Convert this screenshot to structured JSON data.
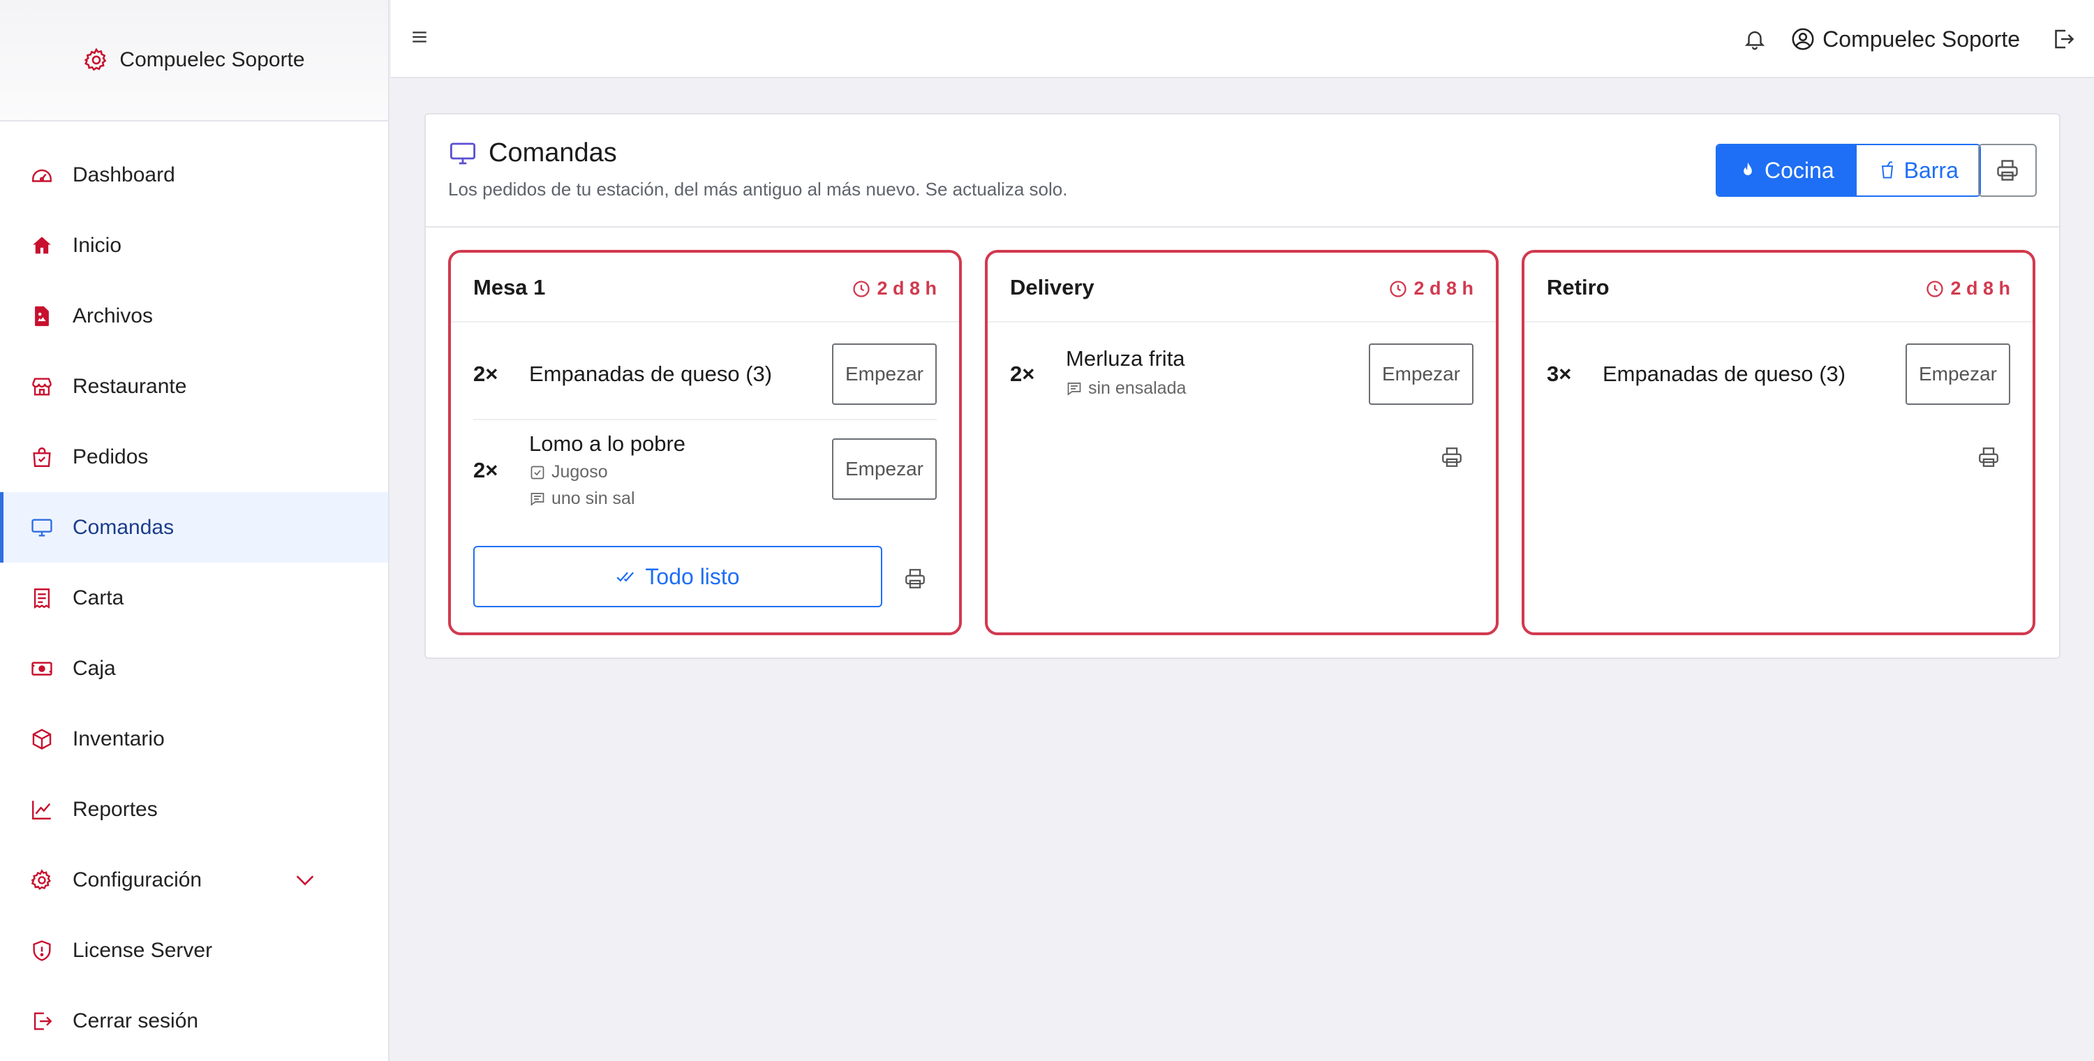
{
  "brand": {
    "name": "Compuelec Soporte"
  },
  "sidebar": {
    "items": [
      {
        "label": "Dashboard",
        "icon": "speedometer-icon"
      },
      {
        "label": "Inicio",
        "icon": "home-icon"
      },
      {
        "label": "Archivos",
        "icon": "file-image-icon"
      },
      {
        "label": "Restaurante",
        "icon": "shop-icon"
      },
      {
        "label": "Pedidos",
        "icon": "bag-check-icon"
      },
      {
        "label": "Comandas",
        "icon": "display-icon",
        "active": true
      },
      {
        "label": "Carta",
        "icon": "receipt-icon"
      },
      {
        "label": "Caja",
        "icon": "cash-icon"
      },
      {
        "label": "Inventario",
        "icon": "box-icon"
      },
      {
        "label": "Reportes",
        "icon": "graph-icon"
      },
      {
        "label": "Configuración",
        "icon": "gear-icon",
        "expandable": true
      },
      {
        "label": "License Server",
        "icon": "shield-icon"
      },
      {
        "label": "Cerrar sesión",
        "icon": "logout-icon"
      }
    ]
  },
  "topbar": {
    "user_name": "Compuelec Soporte"
  },
  "panel": {
    "title": "Comandas",
    "subtitle": "Los pedidos de tu estación, del más antiguo al más nuevo. Se actualiza solo.",
    "stations": [
      {
        "label": "Cocina",
        "icon": "fire-icon",
        "selected": true
      },
      {
        "label": "Barra",
        "icon": "cup-icon",
        "selected": false
      }
    ]
  },
  "orders": [
    {
      "title": "Mesa 1",
      "age": "2 d 8 h",
      "items": [
        {
          "qty": "2×",
          "name": "Empanadas de queso (3)",
          "action": "Empezar"
        },
        {
          "qty": "2×",
          "name": "Lomo a lo pobre",
          "option": "Jugoso",
          "comment": "uno sin sal",
          "action": "Empezar"
        }
      ],
      "all_ready_label": "Todo listo"
    },
    {
      "title": "Delivery",
      "age": "2 d 8 h",
      "items": [
        {
          "qty": "2×",
          "name": "Merluza frita",
          "comment": "sin ensalada",
          "action": "Empezar"
        }
      ]
    },
    {
      "title": "Retiro",
      "age": "2 d 8 h",
      "items": [
        {
          "qty": "3×",
          "name": "Empanadas de queso (3)",
          "action": "Empezar"
        }
      ]
    }
  ],
  "colors": {
    "accent": "#1e6ff5",
    "danger": "#d13a4f",
    "brand_red": "#c8102e",
    "active_bg": "#eef4ff"
  }
}
